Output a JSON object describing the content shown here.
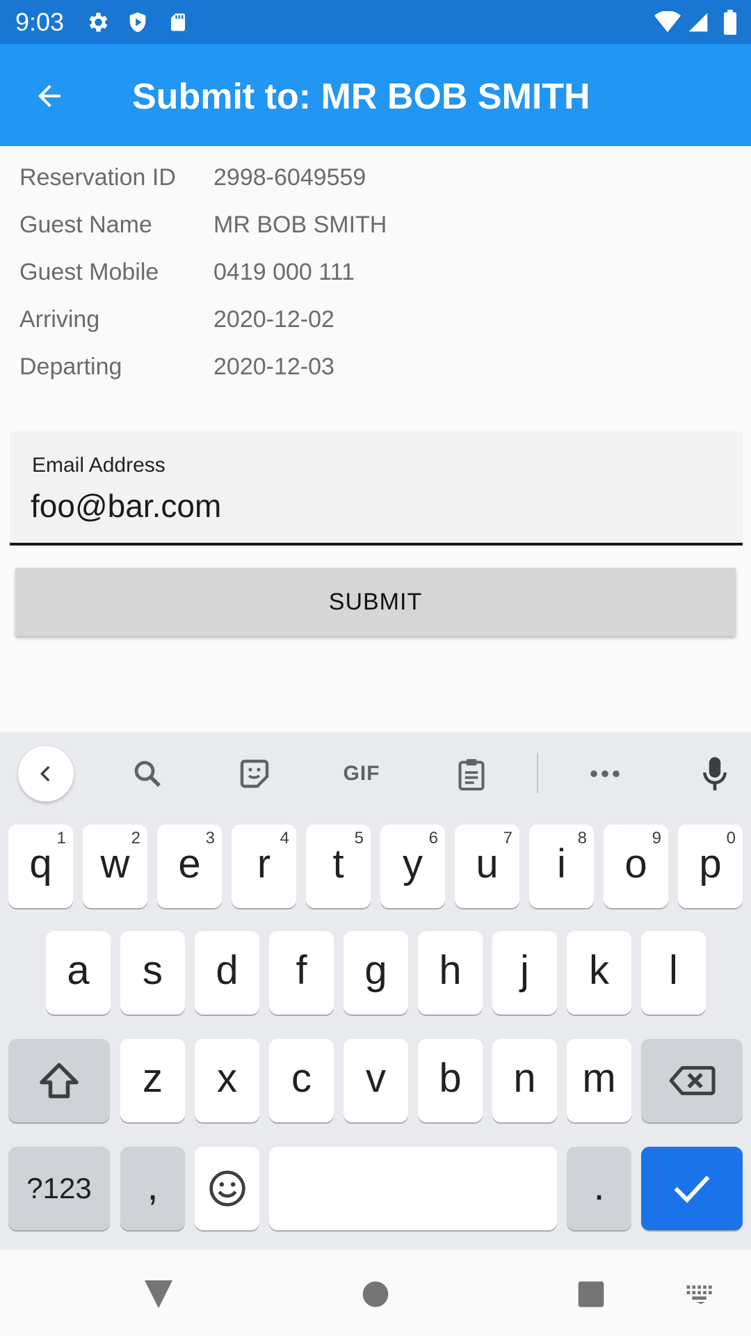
{
  "status_bar": {
    "time": "9:03",
    "icons": [
      "settings-icon",
      "shield-icon",
      "sd-card-icon",
      "wifi-icon",
      "signal-icon",
      "battery-icon"
    ]
  },
  "app_bar": {
    "title": "Submit to: MR BOB SMITH",
    "back_icon": "arrow-back-icon"
  },
  "details": [
    {
      "label": "Reservation ID",
      "value": "2998-6049559"
    },
    {
      "label": "Guest Name",
      "value": "MR BOB SMITH"
    },
    {
      "label": "Guest Mobile",
      "value": "0419 000 111"
    },
    {
      "label": "Arriving",
      "value": "2020-12-02"
    },
    {
      "label": "Departing",
      "value": "2020-12-03"
    }
  ],
  "email": {
    "label": "Email Address",
    "value": "foo@bar.com"
  },
  "submit": {
    "label": "SUBMIT"
  },
  "keyboard": {
    "toolbar": {
      "gif_label": "GIF",
      "icons": [
        "chevron-left-icon",
        "search-icon",
        "sticker-icon",
        "gif-icon",
        "clipboard-icon",
        "more-icon",
        "mic-icon"
      ]
    },
    "row1": [
      {
        "ch": "q",
        "hint": "1"
      },
      {
        "ch": "w",
        "hint": "2"
      },
      {
        "ch": "e",
        "hint": "3"
      },
      {
        "ch": "r",
        "hint": "4"
      },
      {
        "ch": "t",
        "hint": "5"
      },
      {
        "ch": "y",
        "hint": "6"
      },
      {
        "ch": "u",
        "hint": "7"
      },
      {
        "ch": "i",
        "hint": "8"
      },
      {
        "ch": "o",
        "hint": "9"
      },
      {
        "ch": "p",
        "hint": "0"
      }
    ],
    "row2": [
      "a",
      "s",
      "d",
      "f",
      "g",
      "h",
      "j",
      "k",
      "l"
    ],
    "row3": [
      "z",
      "x",
      "c",
      "v",
      "b",
      "n",
      "m"
    ],
    "row4": {
      "symbols": "?123",
      "comma": ",",
      "period": "."
    },
    "colors": {
      "background": "#e8eaed",
      "key": "#ffffff",
      "action_key": "#1a73e8",
      "modifier_key": "#cfd2d6"
    }
  },
  "colors": {
    "status_bar": "#1976d2",
    "app_bar": "#2196f3",
    "submit_button": "#d6d6d6"
  },
  "nav_bar": {
    "icons": [
      "back-triangle-icon",
      "home-circle-icon",
      "recents-square-icon",
      "keyboard-switch-icon"
    ]
  }
}
